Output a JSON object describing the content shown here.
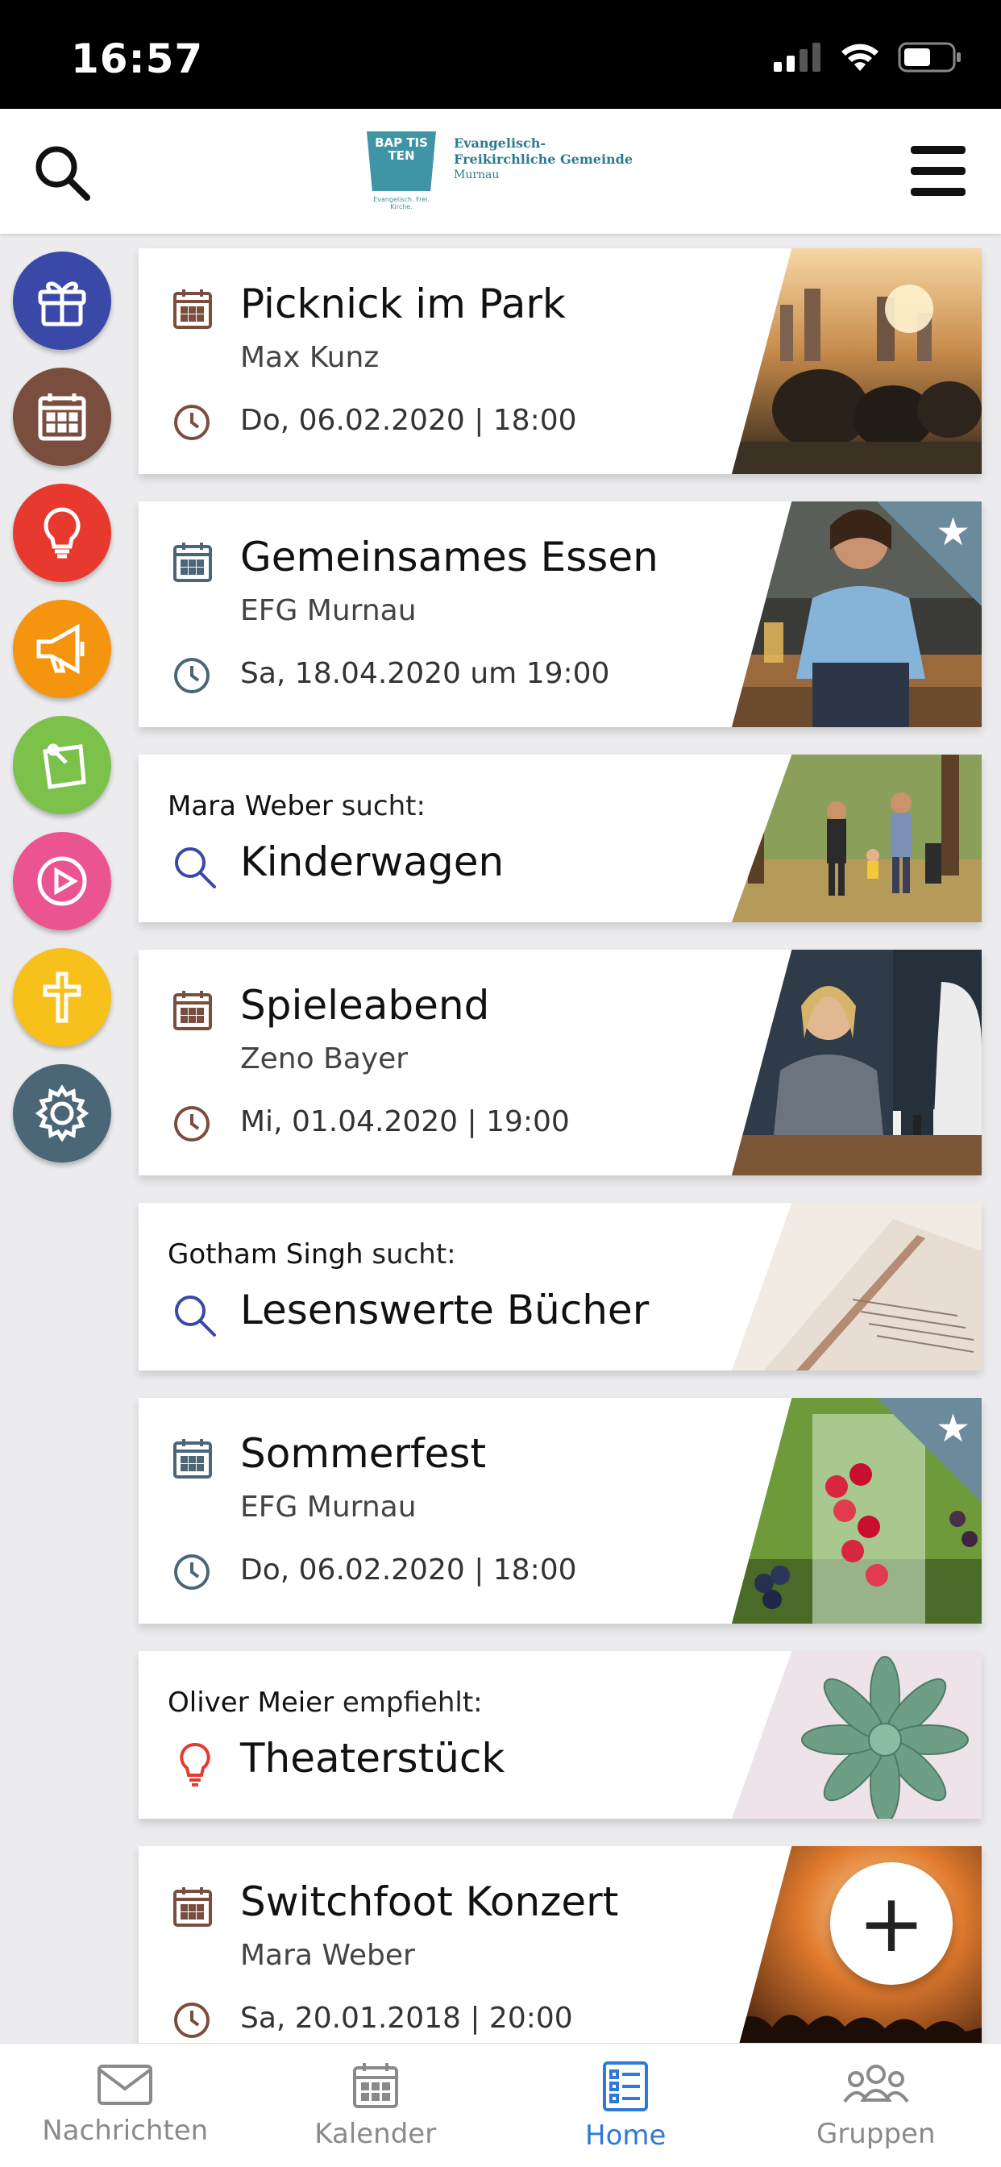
{
  "status_bar": {
    "time": "16:57"
  },
  "header": {
    "logo": {
      "badge": "BAP TIS TEN",
      "badge_sub": "Evangelisch. Frei. Kirche.",
      "line1": "Evangelisch-",
      "line2": "Freikirchliche Gemeinde",
      "line3": "Murnau"
    }
  },
  "categories": [
    {
      "name": "gift",
      "color": "#3a48a8"
    },
    {
      "name": "calendar",
      "color": "#7a4e3f"
    },
    {
      "name": "bulb",
      "color": "#e8392e"
    },
    {
      "name": "megaphone",
      "color": "#f4940f"
    },
    {
      "name": "note",
      "color": "#7cc24a"
    },
    {
      "name": "play",
      "color": "#ea5591"
    },
    {
      "name": "cross",
      "color": "#f7c01b"
    },
    {
      "name": "gear",
      "color": "#4b6777"
    }
  ],
  "feed": [
    {
      "type": "event",
      "title": "Picknick im Park",
      "subtitle": "Max Kunz",
      "date": "Do, 06.02.2020 | 18:00",
      "icon_color": "#7a4e3f",
      "starred": false
    },
    {
      "type": "event",
      "title": "Gemeinsames Essen",
      "subtitle": "EFG Murnau",
      "date": "Sa, 18.04.2020 um 19:00",
      "icon_color": "#4b6777",
      "starred": true
    },
    {
      "type": "search",
      "person": "Mara Weber",
      "verb": "sucht:",
      "title": "Kinderwagen",
      "icon_color": "#3a48a8"
    },
    {
      "type": "event",
      "title": "Spieleabend",
      "subtitle": "Zeno Bayer",
      "date": "Mi, 01.04.2020 | 19:00",
      "icon_color": "#7a4e3f",
      "starred": false
    },
    {
      "type": "search",
      "person": "Gotham Singh",
      "verb": "sucht:",
      "title": "Lesenswerte Bücher",
      "icon_color": "#3a48a8"
    },
    {
      "type": "event",
      "title": "Sommerfest",
      "subtitle": "EFG Murnau",
      "date": "Do, 06.02.2020 | 18:00",
      "icon_color": "#4b6777",
      "starred": true
    },
    {
      "type": "recommend",
      "person": "Oliver Meier",
      "verb": "empfiehlt:",
      "title": "Theaterstück",
      "icon_color": "#e8392e"
    },
    {
      "type": "event",
      "title": "Switchfoot Konzert",
      "subtitle": "Mara Weber",
      "date": "Sa, 20.01.2018 | 20:00",
      "icon_color": "#7a4e3f",
      "starred": false
    }
  ],
  "fab": {
    "label": "+"
  },
  "tabs": [
    {
      "label": "Nachrichten"
    },
    {
      "label": "Kalender"
    },
    {
      "label": "Home"
    },
    {
      "label": "Gruppen"
    }
  ]
}
